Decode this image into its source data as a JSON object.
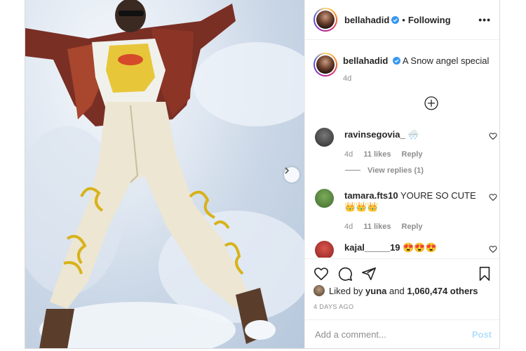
{
  "post": {
    "username": "bellahadid",
    "follow_status": "Following",
    "separator": "•",
    "more": "•••"
  },
  "caption": {
    "username": "bellahadid",
    "text": "A Snow angel special",
    "age": "4d"
  },
  "comments": [
    {
      "username": "ravinsegovia_",
      "text": "🌨️",
      "age": "4d",
      "likes": "11 likes",
      "reply": "Reply",
      "avatar_color": "#2b2b2b"
    },
    {
      "username": "tamara.fts10",
      "text": "YOURE SO CUTE👑👑👑",
      "age": "4d",
      "likes": "11 likes",
      "reply": "Reply",
      "avatar_color": "#3f6b2e"
    },
    {
      "username": "kajal_____19",
      "text": "😍😍😍",
      "avatar_color": "#8a1f1f"
    }
  ],
  "view_replies": "View replies (1)",
  "likes": {
    "prefix": "Liked by",
    "user": "yuna",
    "joiner": "and",
    "others": "1,060,474 others"
  },
  "date": "4 DAYS AGO",
  "add_comment": {
    "placeholder": "Add a comment...",
    "post_label": "Post"
  },
  "icons": {
    "verified": "verified-badge-icon",
    "plus": "plus-circle-icon",
    "heart": "heart-icon",
    "comment": "comment-icon",
    "share": "paper-plane-icon",
    "save": "bookmark-icon",
    "next": "chevron-right-icon"
  },
  "colors": {
    "verified_blue": "#3897f0",
    "muted_text": "#8e8e8e",
    "post_button_disabled": "#b2dffc"
  }
}
